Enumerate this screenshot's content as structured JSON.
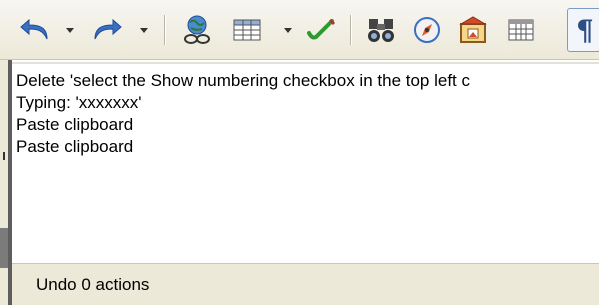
{
  "toolbar": {
    "items": [
      {
        "name": "undo-icon",
        "has_dropdown": true
      },
      {
        "name": "redo-icon",
        "has_dropdown": true
      },
      {
        "name": "hyperlink-icon",
        "has_dropdown": false
      },
      {
        "name": "table-icon",
        "has_dropdown": true
      },
      {
        "name": "draw-functions-icon",
        "has_dropdown": false
      },
      {
        "name": "find-replace-icon",
        "has_dropdown": false
      },
      {
        "name": "navigator-icon",
        "has_dropdown": false
      },
      {
        "name": "gallery-icon",
        "has_dropdown": false
      },
      {
        "name": "data-sources-icon",
        "has_dropdown": false
      },
      {
        "name": "formatting-marks-icon",
        "has_dropdown": false
      }
    ],
    "pilcrow_glyph": "¶"
  },
  "undo_list": {
    "items": [
      "Delete 'select the Show numbering checkbox in the top left c",
      "Typing: 'xxxxxxx'",
      "Paste clipboard",
      "Paste clipboard"
    ],
    "status": "Undo 0 actions"
  },
  "colors": {
    "toolbar_bg": "#ece9d8",
    "undo_arrow": "#3a6fc4",
    "accent_border": "#7a9cc9"
  }
}
